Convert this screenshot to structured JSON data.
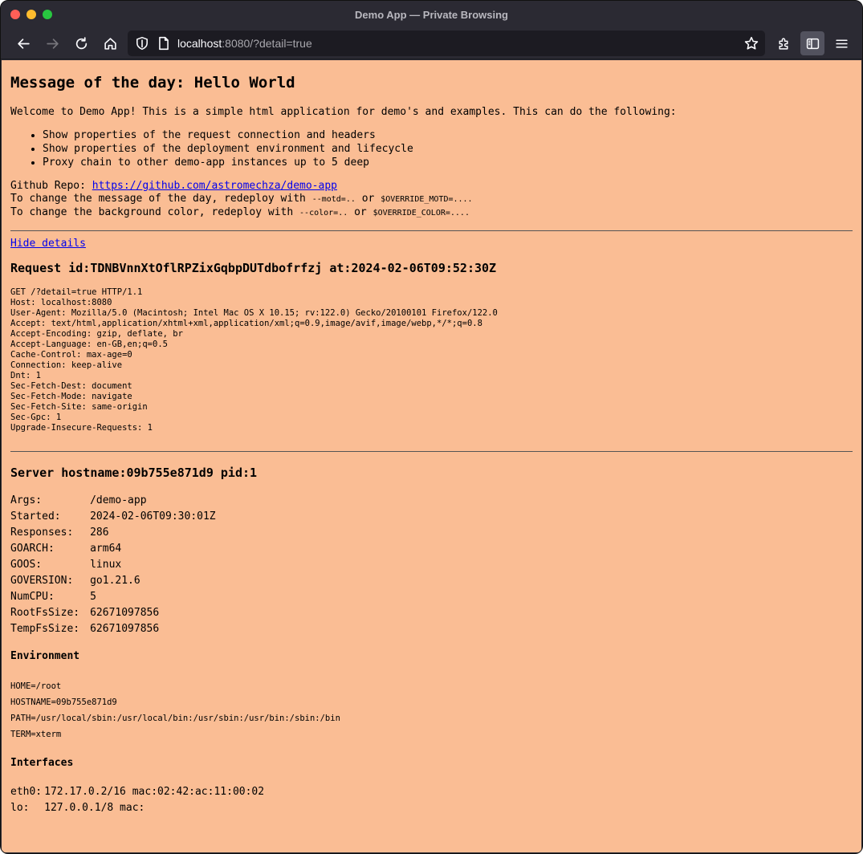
{
  "window": {
    "title": "Demo App — Private Browsing"
  },
  "toolbar": {
    "url_host": "localhost",
    "url_rest": ":8080/?detail=true"
  },
  "page": {
    "motd_heading": "Message of the day: Hello World",
    "intro": "Welcome to Demo App! This is a simple html application for demo's and examples. This can do the following:",
    "features": [
      "Show properties of the request connection and headers",
      "Show properties of the deployment environment and lifecycle",
      "Proxy chain to other demo-app instances up to 5 deep"
    ],
    "repo_label": "Github Repo: ",
    "repo_link": "https://github.com/astromechza/demo-app",
    "motd_change_prefix": "To change the message of the day, redeploy with ",
    "motd_flag": "--motd=..",
    "or1": " or ",
    "motd_env": "$OVERRIDE_MOTD=....",
    "color_change_prefix": "To change the background color, redeploy with ",
    "color_flag": "--color=..",
    "or2": " or ",
    "color_env": "$OVERRIDE_COLOR=....",
    "hide_details": "Hide details",
    "request_heading": "Request id:TDNBVnnXtOflRPZixGqbpDUTdbofrfzj at:2024-02-06T09:52:30Z",
    "request_headers": [
      "GET /?detail=true HTTP/1.1",
      "Host: localhost:8080",
      "User-Agent: Mozilla/5.0 (Macintosh; Intel Mac OS X 10.15; rv:122.0) Gecko/20100101 Firefox/122.0",
      "Accept: text/html,application/xhtml+xml,application/xml;q=0.9,image/avif,image/webp,*/*;q=0.8",
      "Accept-Encoding: gzip, deflate, br",
      "Accept-Language: en-GB,en;q=0.5",
      "Cache-Control: max-age=0",
      "Connection: keep-alive",
      "Dnt: 1",
      "Sec-Fetch-Dest: document",
      "Sec-Fetch-Mode: navigate",
      "Sec-Fetch-Site: same-origin",
      "Sec-Gpc: 1",
      "Upgrade-Insecure-Requests: 1"
    ],
    "server_heading": "Server hostname:09b755e871d9 pid:1",
    "server_info": [
      {
        "key": "Args:",
        "value": "/demo-app"
      },
      {
        "key": "Started:",
        "value": "2024-02-06T09:30:01Z"
      },
      {
        "key": "Responses:",
        "value": "286"
      },
      {
        "key": "GOARCH:",
        "value": "arm64"
      },
      {
        "key": "GOOS:",
        "value": "linux"
      },
      {
        "key": "GOVERSION:",
        "value": "go1.21.6"
      },
      {
        "key": "NumCPU:",
        "value": "5"
      },
      {
        "key": "RootFsSize:",
        "value": "62671097856"
      },
      {
        "key": "TempFsSize:",
        "value": "62671097856"
      }
    ],
    "environment_heading": "Environment",
    "environment": [
      "HOME=/root",
      "HOSTNAME=09b755e871d9",
      "PATH=/usr/local/sbin:/usr/local/bin:/usr/sbin:/usr/bin:/sbin:/bin",
      "TERM=xterm"
    ],
    "interfaces_heading": "Interfaces",
    "interfaces": [
      {
        "name": "eth0:",
        "value": "172.17.0.2/16 mac:02:42:ac:11:00:02"
      },
      {
        "name": "lo:",
        "value": "127.0.0.1/8 mac:"
      }
    ]
  }
}
